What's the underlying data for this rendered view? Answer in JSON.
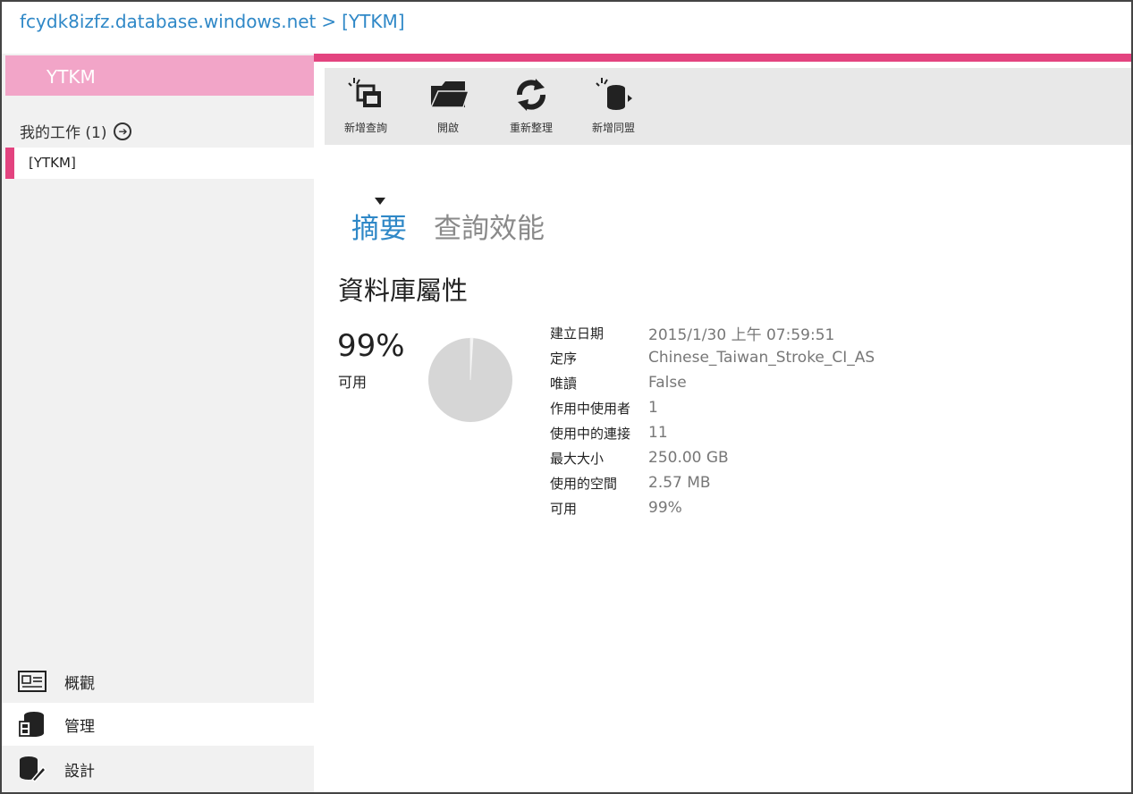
{
  "breadcrumb": {
    "server": "fcydk8izfz.database.windows.net",
    "separator": ">",
    "database": "[YTKM]"
  },
  "sidebar": {
    "db_title": "YTKM",
    "my_work_label": "我的工作 (1)",
    "work_items": [
      "[YTKM]"
    ],
    "nav": [
      {
        "label": "概觀",
        "icon": "overview-icon"
      },
      {
        "label": "管理",
        "icon": "manage-icon"
      },
      {
        "label": "設計",
        "icon": "design-icon"
      }
    ],
    "active_nav": "管理"
  },
  "toolbar": {
    "new_query": "新增查詢",
    "open": "開啟",
    "refresh": "重新整理",
    "new_federation": "新增同盟"
  },
  "tabs": {
    "summary": "摘要",
    "query_performance": "查詢效能"
  },
  "section_title": "資料庫屬性",
  "availability": {
    "percent_text": "99%",
    "label": "可用",
    "used_fraction": 0.01
  },
  "properties": [
    {
      "key": "建立日期",
      "value": "2015/1/30 上午 07:59:51"
    },
    {
      "key": "定序",
      "value": "Chinese_Taiwan_Stroke_CI_AS"
    },
    {
      "key": "唯讀",
      "value": "False"
    },
    {
      "key": "作用中使用者",
      "value": "1"
    },
    {
      "key": "使用中的連接",
      "value": "11"
    },
    {
      "key": "最大大小",
      "value": "250.00 GB"
    },
    {
      "key": "使用的空間",
      "value": "2.57 MB"
    },
    {
      "key": "可用",
      "value": "99%"
    }
  ],
  "colors": {
    "accent": "#e3437f",
    "link": "#2f88c7",
    "db_title_bg": "#f2a5c8",
    "pie_fill": "#d6d6d6"
  }
}
